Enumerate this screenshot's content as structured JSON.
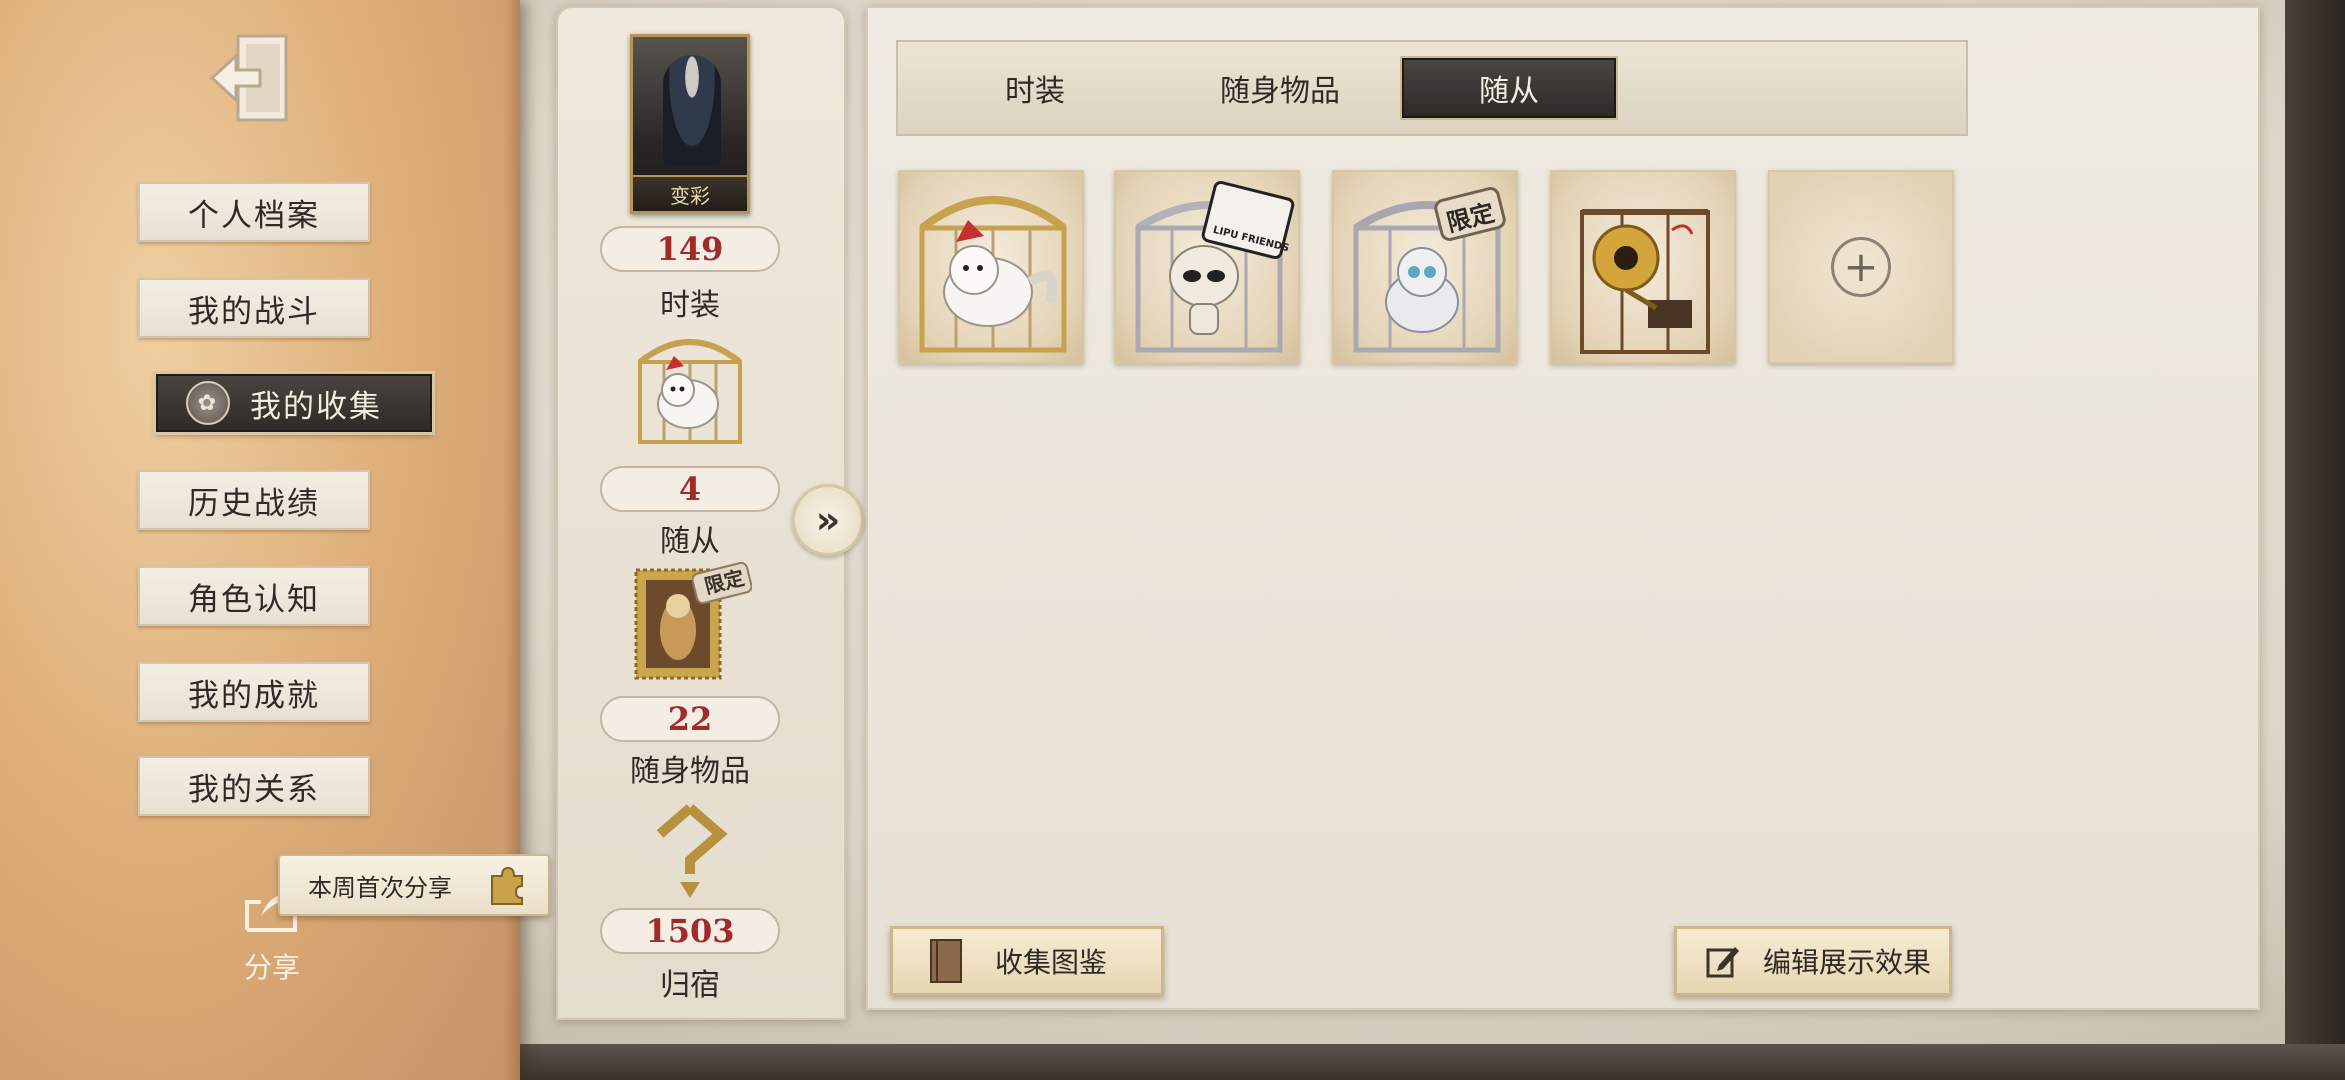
{
  "sidebar": {
    "exit_icon": "exit-door-icon",
    "items": [
      {
        "label": "个人档案"
      },
      {
        "label": "我的战斗"
      },
      {
        "label": "我的收集"
      },
      {
        "label": "历史战绩"
      },
      {
        "label": "角色认知"
      },
      {
        "label": "我的成就"
      },
      {
        "label": "我的关系"
      }
    ],
    "active_index": 2,
    "share_label": "分享",
    "share_tip": "本周首次分享"
  },
  "stats": {
    "portrait_name": "变彩",
    "costume_count": "149",
    "costume_label": "时装",
    "follower_count": "4",
    "follower_label": "随从",
    "accessory_badge": "限定",
    "accessory_count": "22",
    "accessory_label": "随身物品",
    "homestead_count": "1503",
    "homestead_label": "归宿"
  },
  "tabs": [
    {
      "label": "时装"
    },
    {
      "label": "随身物品"
    },
    {
      "label": "随从"
    }
  ],
  "active_tab": 2,
  "items": [
    {
      "name": "white-fox-pet",
      "badge": ""
    },
    {
      "name": "lipu-friends-pet",
      "badge": "LIPU FRIENDS"
    },
    {
      "name": "grey-fox-pet",
      "badge": "限定"
    },
    {
      "name": "gramophone-pet",
      "badge": ""
    }
  ],
  "add_slot_icon": "plus-icon",
  "buttons": {
    "collection_book": "收集图鉴",
    "edit_display": "编辑展示效果"
  },
  "colors": {
    "count_red": "#a22a2a",
    "active_dark": "#2e2a27",
    "sidebar_tan": "#dfb07a"
  }
}
